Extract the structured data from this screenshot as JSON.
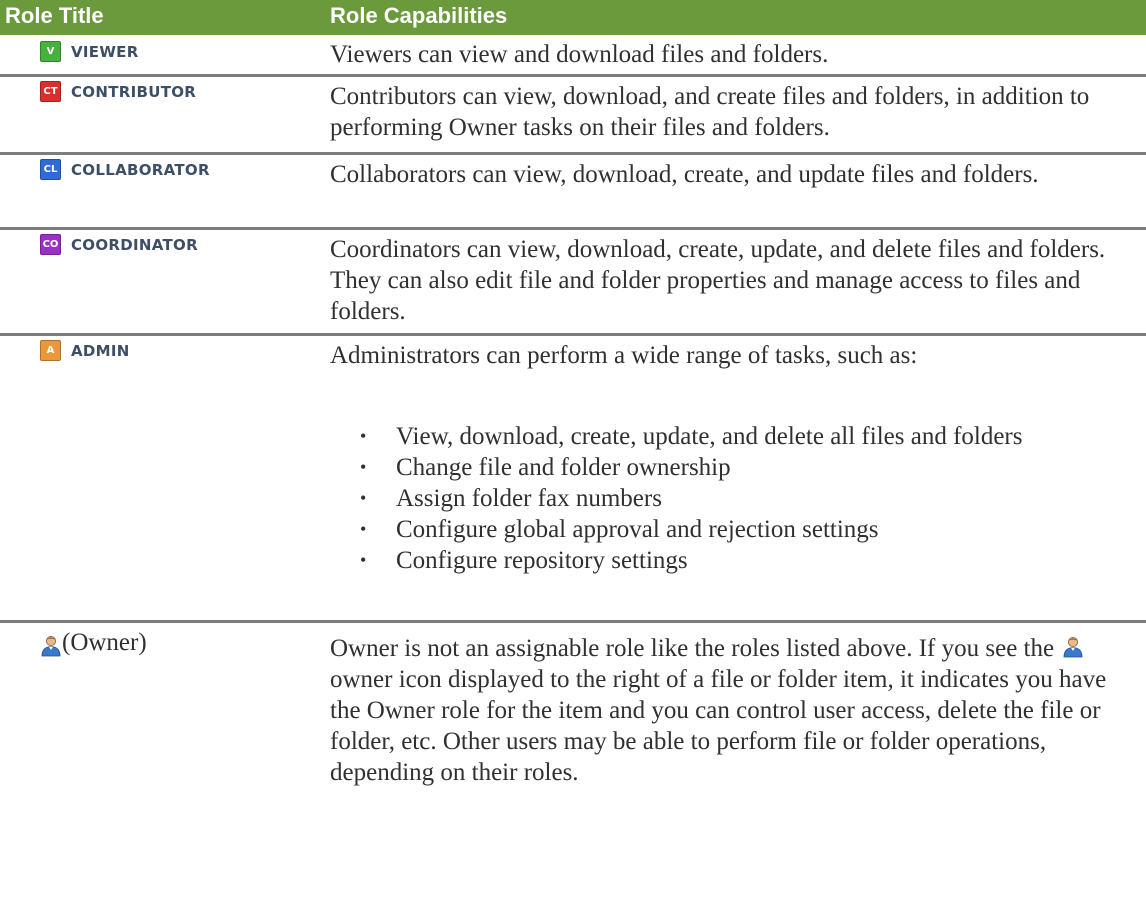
{
  "header": {
    "col1": "Role Title",
    "col2": "Role Capabilities"
  },
  "colors": {
    "header_bg": "#6a9a3c",
    "viewer": "#46b13c",
    "contributor": "#d8302c",
    "collaborator": "#2f6bd6",
    "coordinator": "#9b2fc6",
    "admin": "#e89a3a"
  },
  "roles": [
    {
      "badge": "V",
      "icon": "viewer-badge-icon",
      "name": "VIEWER",
      "description": "Viewers can view and download files and folders."
    },
    {
      "badge": "CT",
      "icon": "contributor-badge-icon",
      "name": "CONTRIBUTOR",
      "description": "Contributors can view, download, and create files and folders, in addition to performing Owner tasks on their files and folders."
    },
    {
      "badge": "CL",
      "icon": "collaborator-badge-icon",
      "name": "COLLABORATOR",
      "description": "Collaborators can view, download, create, and update files and folders."
    },
    {
      "badge": "CO",
      "icon": "coordinator-badge-icon",
      "name": "COORDINATOR",
      "description": "Coordinators can view, download, create, update, and delete files and folders. They can also edit file and folder properties and manage access to files and folders."
    },
    {
      "badge": "A",
      "icon": "admin-badge-icon",
      "name": "ADMIN",
      "description": "Administrators can perform a wide range of tasks, such as:",
      "bullets": [
        "View, download, create, update, and delete all files and folders",
        "Change file and folder ownership",
        "Assign folder fax numbers",
        "Configure global approval and rejection settings",
        "Configure repository settings"
      ]
    }
  ],
  "owner": {
    "icon": "owner-user-icon",
    "label": "(Owner)",
    "text_before_icon": "Owner is not an assignable role like the roles listed above. If you see the",
    "text_after_icon": "owner icon displayed to the right of a file or folder item, it indicates you have the Owner role for the item and you can control user access, delete the file or folder, etc. Other users may be able to perform file or folder operations, depending on their roles."
  }
}
